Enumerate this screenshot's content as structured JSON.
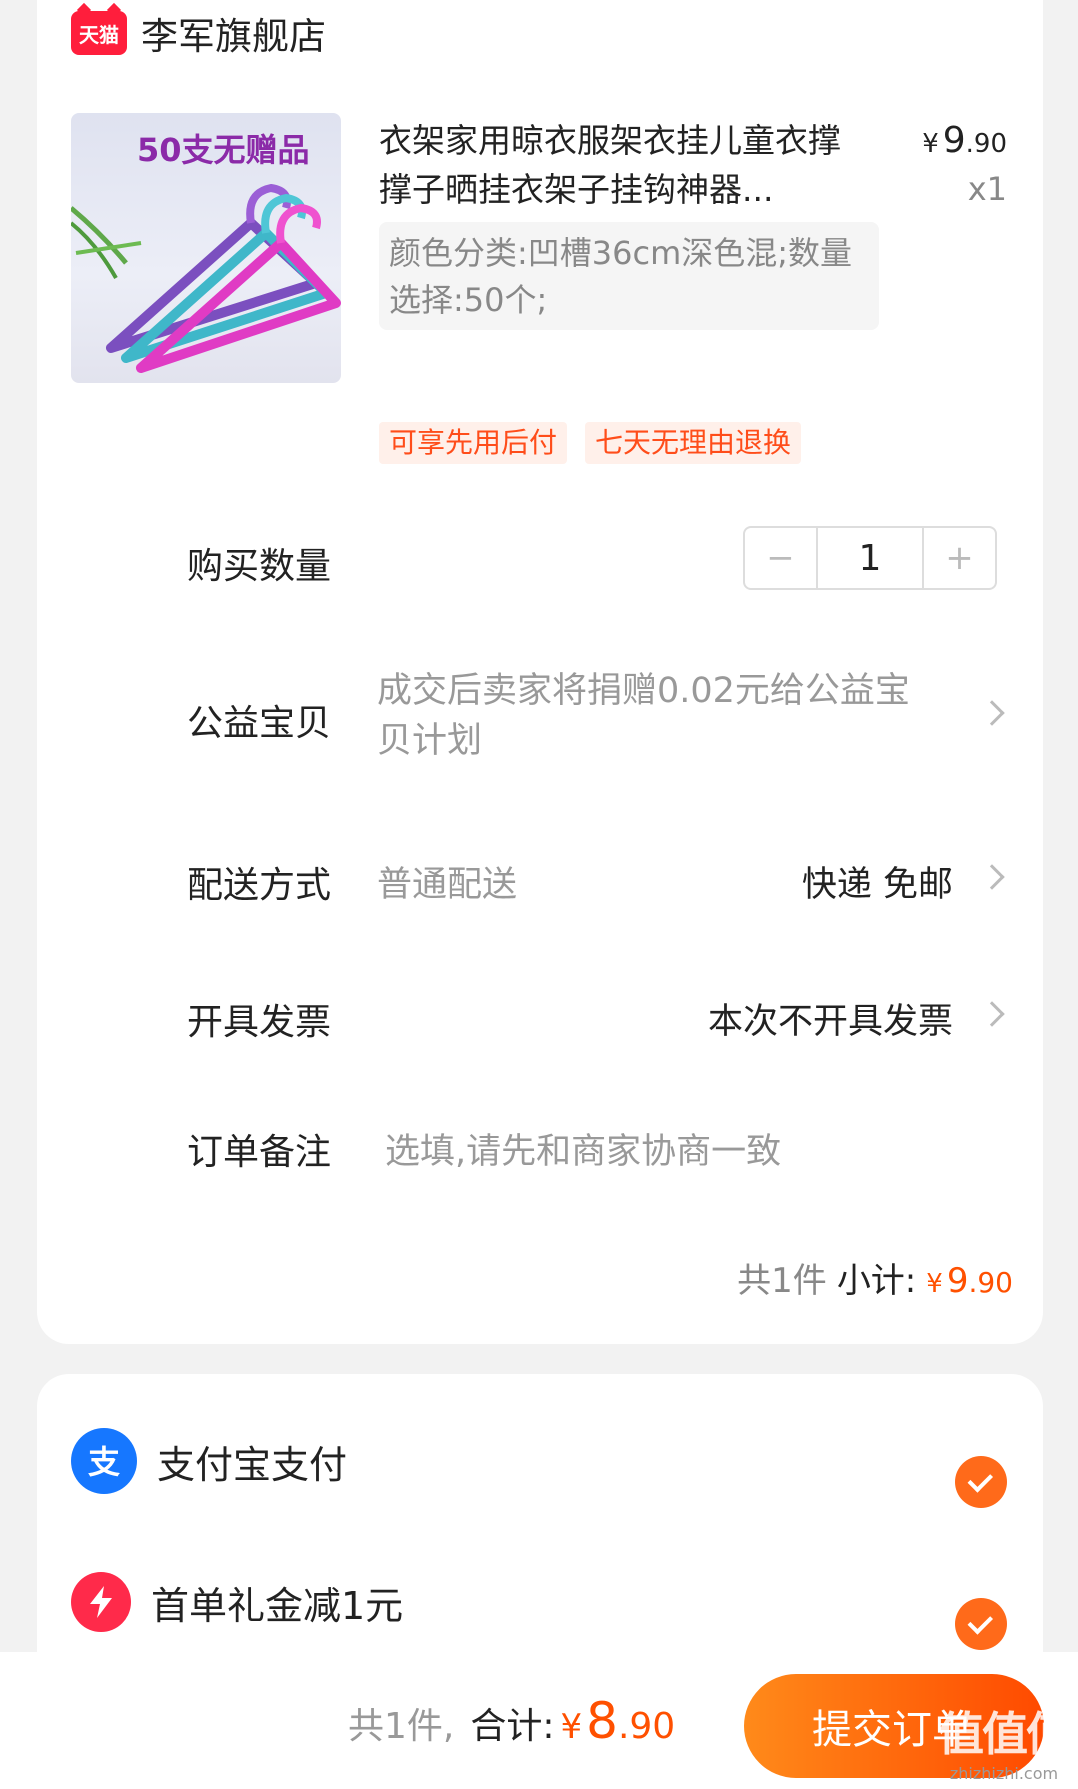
{
  "shop": {
    "badge": "天猫",
    "name": "李军旗舰店"
  },
  "product": {
    "image_promo": "50支无赠品",
    "title": "衣架家用晾衣服架衣挂儿童衣撑撑子晒挂衣架子挂钩神器...",
    "price_symbol": "¥",
    "price_int": "9",
    "price_dec": ".90",
    "quantity_text": "x1",
    "sku": "颜色分类:凹槽36cm深色混;数量选择:50个;",
    "tags": [
      "可享先用后付",
      "七天无理由退换"
    ]
  },
  "rows": {
    "quantity": {
      "label": "购买数量",
      "value": "1",
      "minus": "−",
      "plus": "+"
    },
    "charity": {
      "label": "公益宝贝",
      "value": "成交后卖家将捐赠0.02元给公益宝贝计划"
    },
    "delivery": {
      "label": "配送方式",
      "value": "普通配送",
      "right": "快递 免邮"
    },
    "invoice": {
      "label": "开具发票",
      "right": "本次不开具发票"
    },
    "note": {
      "label": "订单备注",
      "placeholder": "选填,请先和商家协商一致"
    }
  },
  "subtotal": {
    "count": "共1件",
    "label": "小计:",
    "symbol": "¥",
    "int": "9",
    "dec": ".90"
  },
  "payment": {
    "alipay": {
      "icon": "alipay-icon",
      "label": "支付宝支付"
    },
    "coupon": {
      "icon": "bolt-icon",
      "label": "首单礼金减1元"
    }
  },
  "bottom": {
    "count": "共1件,",
    "label": "合计:",
    "symbol": "¥",
    "int": "8",
    "dec": ".90",
    "submit": "提交订单"
  },
  "watermark": {
    "big": "值值值",
    "small": "zhizhizhi.com"
  },
  "colors": {
    "accent": "#ff5000",
    "alipay": "#1677ff",
    "tmall": "#ff1e3c"
  }
}
